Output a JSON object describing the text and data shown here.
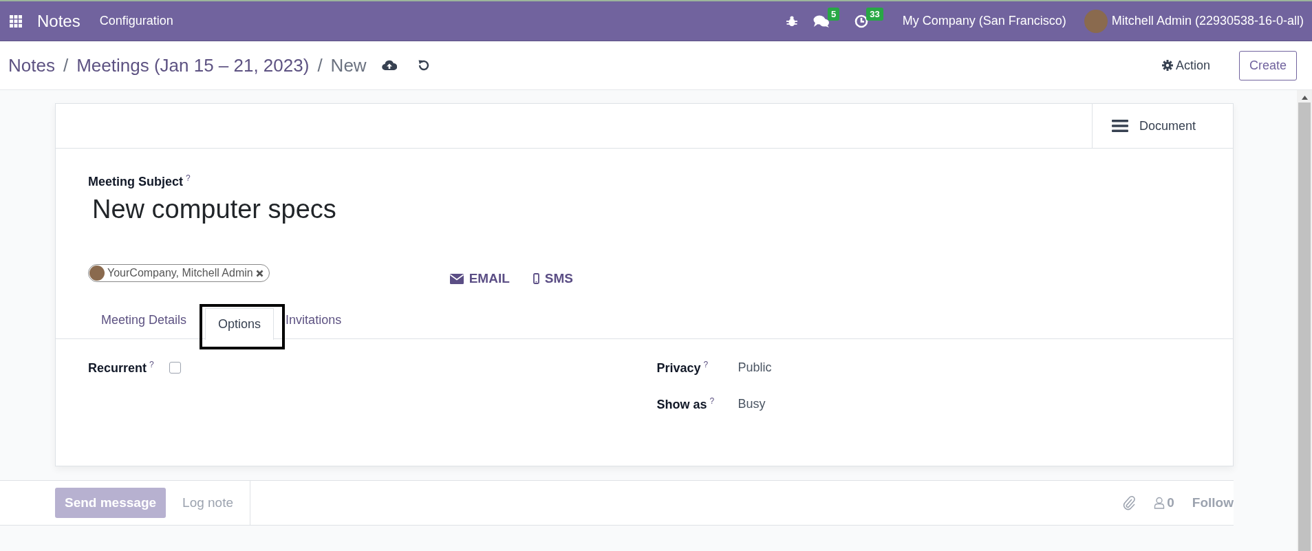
{
  "navbar": {
    "app_name": "Notes",
    "menu": [
      "Configuration"
    ],
    "messages_badge": "5",
    "activities_badge": "33",
    "company": "My Company (San Francisco)",
    "user": "Mitchell Admin (22930538-16-0-all)"
  },
  "breadcrumb": [
    {
      "label": "Notes"
    },
    {
      "label": "Meetings (Jan 15 – 21, 2023)"
    }
  ],
  "breadcrumb_separator": "/",
  "current": "New",
  "action_button": "Action",
  "create_button": "Create",
  "document_button": "Document",
  "form": {
    "subject_label": "Meeting Subject",
    "subject_help": "?",
    "subject": "New computer specs",
    "attendee": "YourCompany, Mitchell Admin"
  },
  "contact_buttons": [
    {
      "kind": "email",
      "label": "EMAIL"
    },
    {
      "kind": "sms",
      "label": "SMS"
    }
  ],
  "tabs": [
    {
      "label": "Meeting Details",
      "selected": false,
      "highlighted": false
    },
    {
      "label": "Options",
      "selected": true,
      "highlighted": true
    },
    {
      "label": "Invitations",
      "selected": false,
      "highlighted": false
    }
  ],
  "left_fields": [
    {
      "kind": "checkbox",
      "label": "Recurrent",
      "help": "?",
      "checked": false
    }
  ],
  "right_fields": [
    {
      "kind": "text",
      "label": "Privacy",
      "help": "?",
      "value": "Public"
    },
    {
      "kind": "text",
      "label": "Show as",
      "help": "?",
      "value": "Busy"
    }
  ],
  "chatter": {
    "send_message": "Send message",
    "log_note": "Log note",
    "followers": "0",
    "follow": "Follow"
  }
}
